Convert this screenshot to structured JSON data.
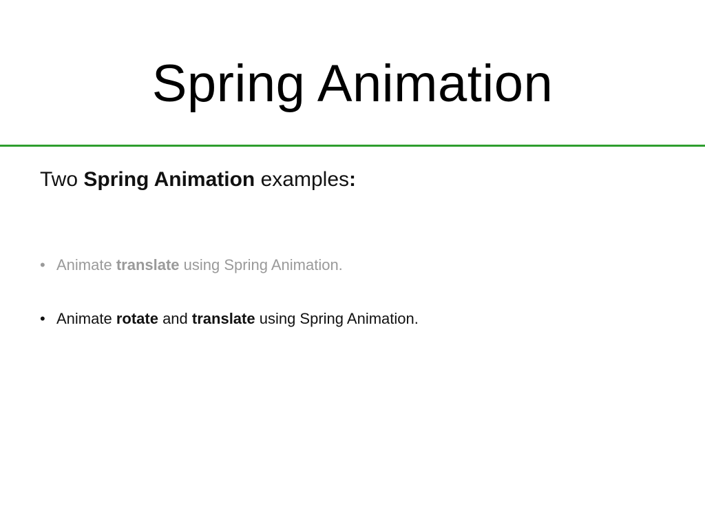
{
  "slide": {
    "title": "Spring Animation",
    "intro": {
      "prefix": "Two",
      "bold": "Spring Animation",
      "suffix": "examples",
      "colon": ":"
    },
    "bullets": [
      {
        "marker": "•",
        "parts": [
          "Animate ",
          "translate",
          " using Spring Animation."
        ]
      },
      {
        "marker": "•",
        "parts": [
          "Animate ",
          "rotate",
          " and ",
          "translate",
          " using Spring Animation."
        ]
      }
    ]
  },
  "colors": {
    "rule": "#2e9e2e",
    "dim_text": "#9a9a9a",
    "text": "#111111"
  }
}
